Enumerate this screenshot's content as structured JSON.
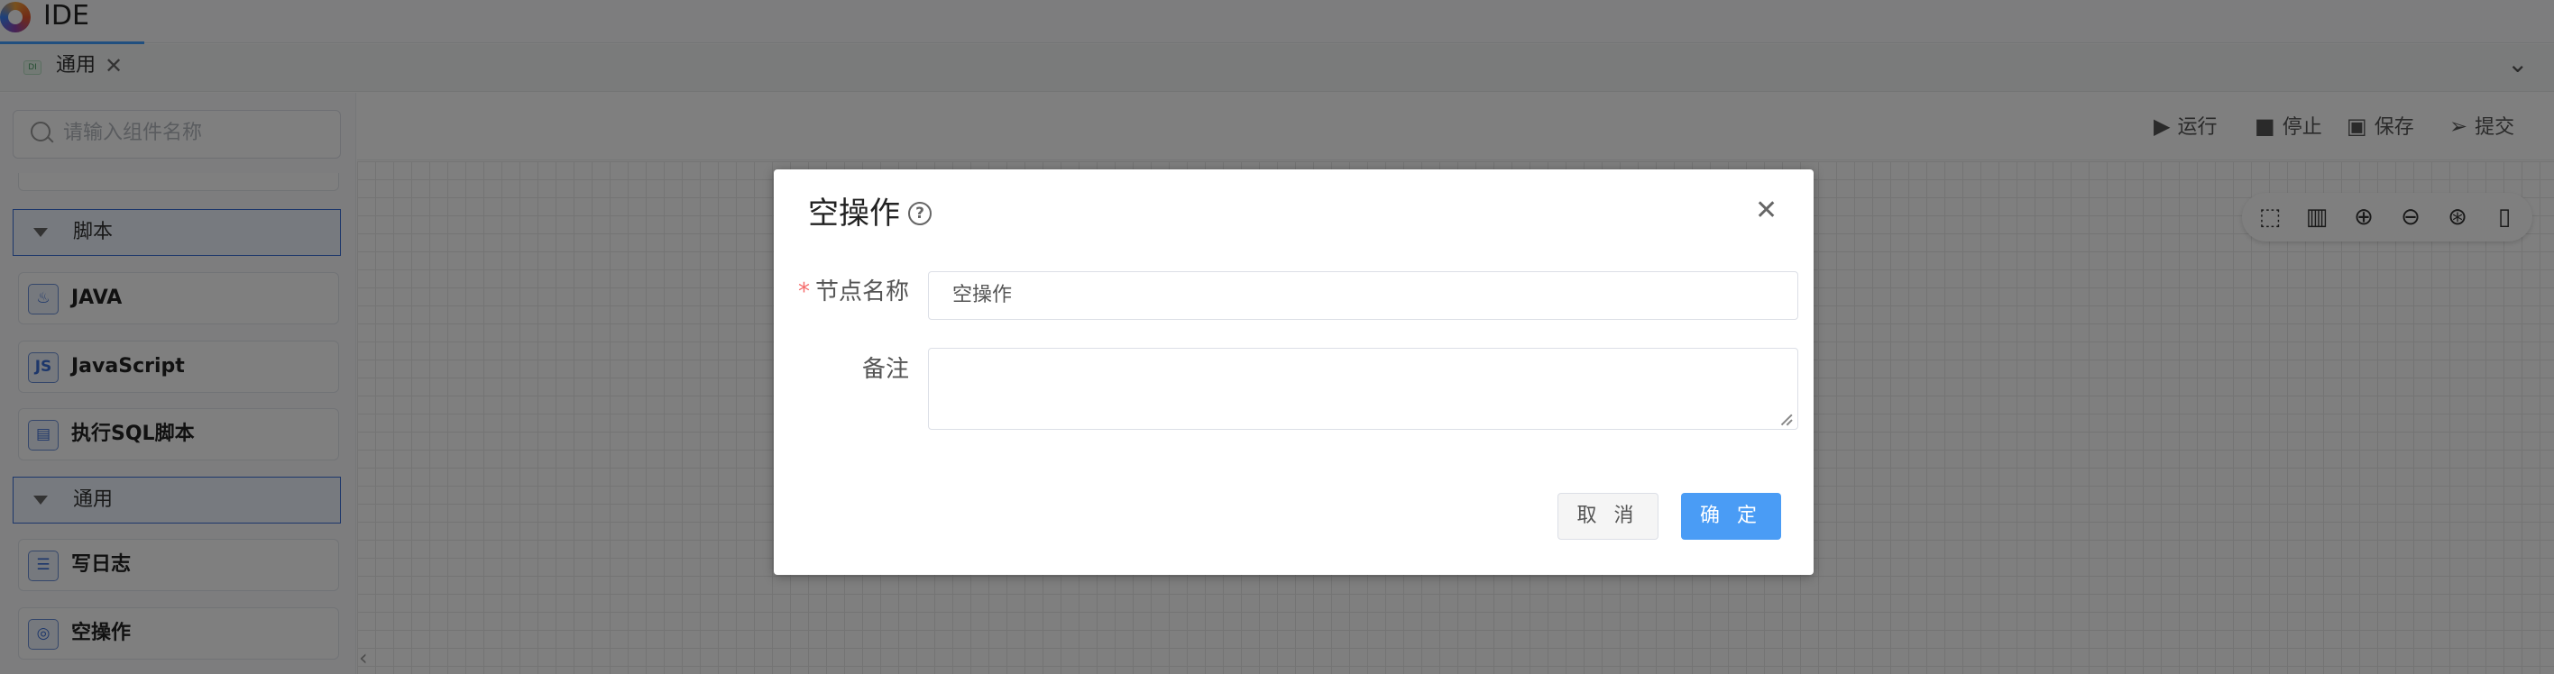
{
  "app": {
    "title": "IDE"
  },
  "tabs": [
    {
      "label": "通用",
      "icon_text": "DI"
    }
  ],
  "sidebar": {
    "search_placeholder": "请输入组件名称",
    "groups": [
      {
        "label": "脚本",
        "items": [
          {
            "label": "JAVA",
            "icon": "java-icon",
            "icon_text": "♨"
          },
          {
            "label": "JavaScript",
            "icon": "js-icon",
            "icon_text": "JS"
          },
          {
            "label": "执行SQL脚本",
            "icon": "sql-icon",
            "icon_text": "▤"
          }
        ]
      },
      {
        "label": "通用",
        "items": [
          {
            "label": "写日志",
            "icon": "log-icon",
            "icon_text": "☰"
          },
          {
            "label": "空操作",
            "icon": "noop-icon",
            "icon_text": "◎"
          }
        ]
      }
    ]
  },
  "toolbar": {
    "run": "运行",
    "stop": "停止",
    "save": "保存",
    "submit": "提交"
  },
  "canvas_tools": [
    "select-icon",
    "fit-icon",
    "zoom-in-icon",
    "zoom-out-icon",
    "locate-icon",
    "bookmark-icon"
  ],
  "dialog": {
    "title": "空操作",
    "node_name_label": "节点名称",
    "node_name_value": "空操作",
    "remark_label": "备注",
    "remark_value": "",
    "cancel": "取 消",
    "confirm": "确 定"
  },
  "colors": {
    "primary": "#4a9cf5",
    "accent": "#3b6fd6",
    "required": "#f56c6c"
  }
}
